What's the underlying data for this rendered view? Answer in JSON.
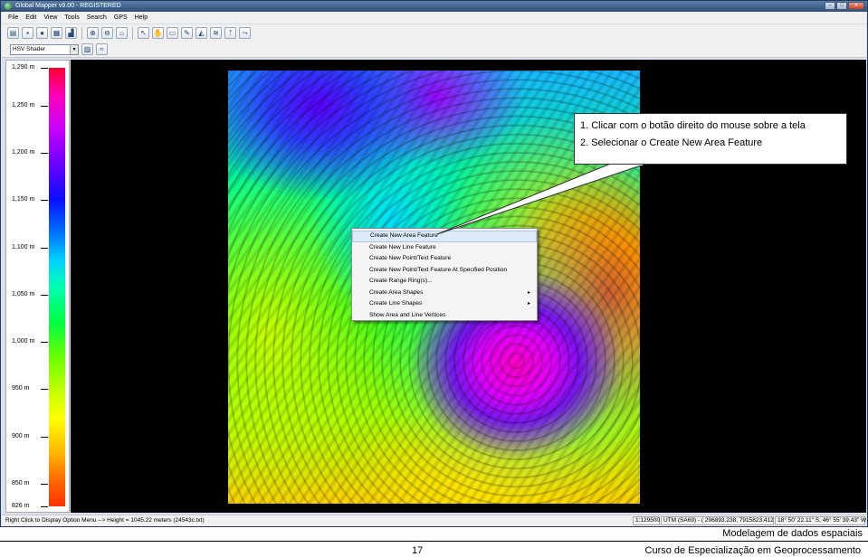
{
  "window": {
    "title": "Global Mapper v9.00 - REGISTERED",
    "controls": [
      "–",
      "□",
      "x"
    ]
  },
  "menu": [
    "File",
    "Edit",
    "View",
    "Tools",
    "Search",
    "GPS",
    "Help"
  ],
  "toolbar": {
    "icons": [
      "open-folder-icon",
      "save-icon",
      "globe-icon",
      "image-icon",
      "chart-icon",
      "zoom-in-icon",
      "zoom-out-icon",
      "home-icon",
      "select-icon",
      "pan-icon",
      "measure-icon",
      "digitizer-icon",
      "terrain-icon",
      "contour-icon",
      "tower-icon",
      "path-profile-icon"
    ]
  },
  "shader": {
    "selected": "HSV Shader",
    "icons": [
      "shaded-relief-icon",
      "water-level-icon"
    ]
  },
  "legend": {
    "labels": [
      "1,290 m",
      "1,250 m",
      "1,200 m",
      "1,150 m",
      "1,100 m",
      "1,050 m",
      "1,000 m",
      "950 m",
      "900 m",
      "850 m",
      "826 m"
    ],
    "min_m": 826,
    "max_m": 1290,
    "colors": [
      "#ff0030",
      "#ff00b4",
      "#c800ff",
      "#0a10ff",
      "#00d4ff",
      "#00ff44",
      "#c8ff00",
      "#ffff00",
      "#ff6a00"
    ]
  },
  "context_menu": {
    "items": [
      {
        "label": "Create New Area Feature",
        "submenu": false,
        "highlighted": true
      },
      {
        "label": "Create New Line Feature",
        "submenu": false
      },
      {
        "label": "Create New Point/Text Feature",
        "submenu": false
      },
      {
        "label": "Create New Point/Text Feature At Specified Position",
        "submenu": false
      },
      {
        "label": "Create Range Ring(s)...",
        "submenu": false
      },
      {
        "label": "Create Area Shapes",
        "submenu": true
      },
      {
        "label": "Create Line Shapes",
        "submenu": true
      },
      {
        "label": "Show Area and Line Vertices",
        "submenu": false
      }
    ],
    "submenu_glyph": "▸"
  },
  "callout": {
    "line1": "1. Clicar com o botão direito do mouse sobre a tela",
    "line2": "2. Selecionar o Create New Area Feature"
  },
  "status": {
    "message": "Right Click to Display Option Menu --> Height = 1045.22 meters (24543c.txt)",
    "scale": "1:129500",
    "projection": "UTM (SA69) - ( 296893.238, 7915823.412 )",
    "latlon": "18° 50' 22.11\" S, 46° 55' 39.43\" W"
  },
  "footer": {
    "title": "Modelagem de dados espaciais",
    "page": "17",
    "course": "Curso de Especialização em Geoprocessamento"
  }
}
